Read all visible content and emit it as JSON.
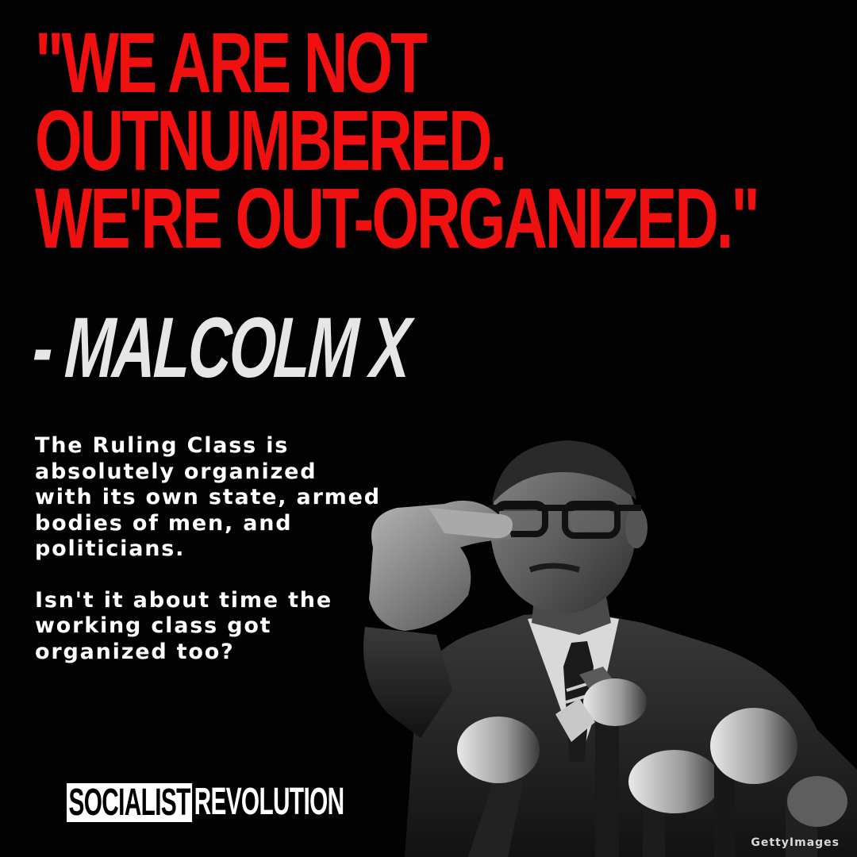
{
  "quote": {
    "lines": [
      "\"WE ARE NOT",
      "OUTNUMBERED.",
      "WE'RE OUT-ORGANIZED.\""
    ],
    "attribution": "- MALCOLM X",
    "color": "#f01010"
  },
  "body": {
    "paragraph1": "The Ruling Class is absolutely organized with its own state, armed bodies of men, and politicians.",
    "paragraph2": "Isn't it about time the working class got organized too?"
  },
  "brand": {
    "boxed_word": "SOCIALIST",
    "word": "REVOLUTION"
  },
  "photo": {
    "credit": "GettyImages"
  },
  "colors": {
    "background": "#020202",
    "accent": "#f01010",
    "attribution": "#e6e6e6",
    "text": "#ffffff"
  }
}
